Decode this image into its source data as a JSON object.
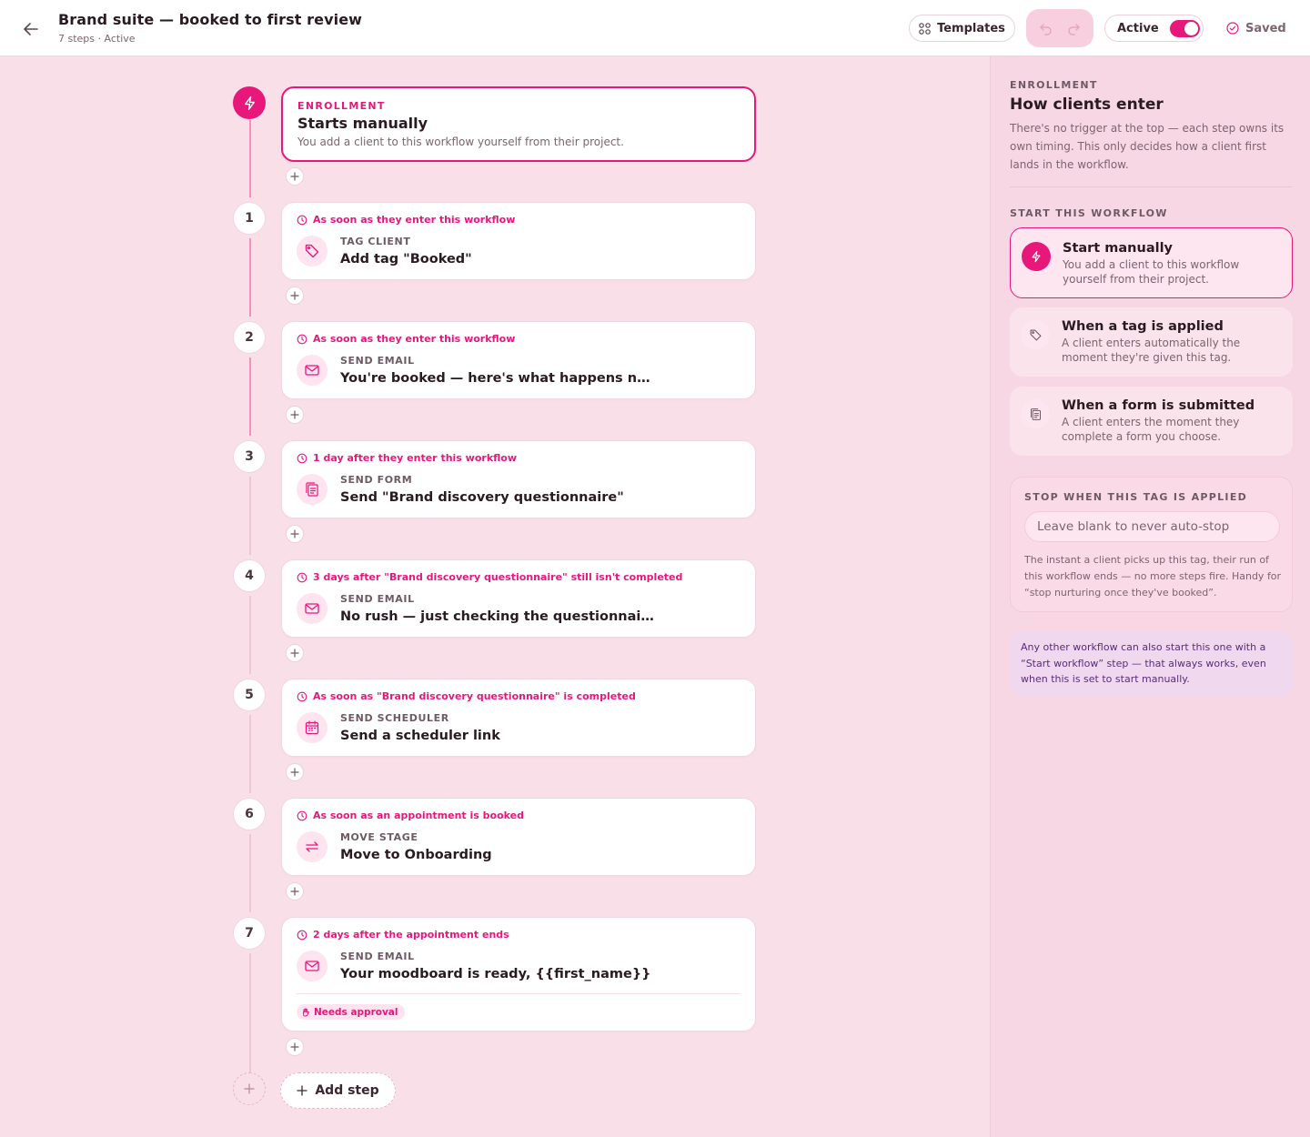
{
  "header": {
    "title": "Brand suite — booked to first review",
    "subtitle": "7 steps · Active",
    "templates_label": "Templates",
    "active_label": "Active",
    "saved_label": "Saved"
  },
  "enrollment": {
    "kind": "ENROLLMENT",
    "title": "Starts manually",
    "desc": "You add a client to this workflow yourself from their project."
  },
  "steps": [
    {
      "num": "1",
      "timing": "As soon as they enter this workflow",
      "kind": "TAG CLIENT",
      "title": "Add tag \"Booked\"",
      "icon": "tag-icon"
    },
    {
      "num": "2",
      "timing": "As soon as they enter this workflow",
      "kind": "SEND EMAIL",
      "title": "You're booked — here's what happens next",
      "icon": "mail-icon"
    },
    {
      "num": "3",
      "timing": "1 day after they enter this workflow",
      "kind": "SEND FORM",
      "title": "Send \"Brand discovery questionnaire\"",
      "icon": "form-icon"
    },
    {
      "num": "4",
      "timing": "3 days after \"Brand discovery questionnaire\" still isn't completed",
      "kind": "SEND EMAIL",
      "title": "No rush — just checking the questionnaire landed",
      "icon": "mail-icon"
    },
    {
      "num": "5",
      "timing": "As soon as \"Brand discovery questionnaire\" is completed",
      "kind": "SEND SCHEDULER",
      "title": "Send a scheduler link",
      "icon": "calendar-icon"
    },
    {
      "num": "6",
      "timing": "As soon as an appointment is booked",
      "kind": "MOVE STAGE",
      "title": "Move to Onboarding",
      "icon": "swap-arrows-icon"
    },
    {
      "num": "7",
      "timing": "2 days after the appointment ends",
      "kind": "SEND EMAIL",
      "title": "Your moodboard is ready, {{first_name}}",
      "icon": "mail-icon",
      "badge": "Needs approval"
    }
  ],
  "add_step_label": "Add step",
  "panel": {
    "label": "ENROLLMENT",
    "title": "How clients enter",
    "desc": "There's no trigger at the top — each step owns its own timing. This only decides how a client first lands in the workflow.",
    "start_label": "START THIS WORKFLOW",
    "options": [
      {
        "title": "Start manually",
        "desc": "You add a client to this workflow yourself from their project.",
        "icon": "lightning-icon",
        "selected": true
      },
      {
        "title": "When a tag is applied",
        "desc": "A client enters automatically the moment they're given this tag.",
        "icon": "tag-icon",
        "selected": false
      },
      {
        "title": "When a form is submitted",
        "desc": "A client enters the moment they complete a form you choose.",
        "icon": "form-icon",
        "selected": false
      }
    ],
    "stop": {
      "label": "STOP WHEN THIS TAG IS APPLIED",
      "value": "",
      "placeholder": "Leave blank to never auto-stop",
      "desc": "The instant a client picks up this tag, their run of this workflow ends — no more steps fire. Handy for “stop nurturing once they've booked”."
    },
    "note": "Any other workflow can also start this one with a “Start workflow” step — that always works, even when this is set to start manually."
  },
  "colors": {
    "accent": "#e8177a",
    "canvas_bg": "#f9dfe8",
    "panel_bg": "#f8d7e4"
  }
}
